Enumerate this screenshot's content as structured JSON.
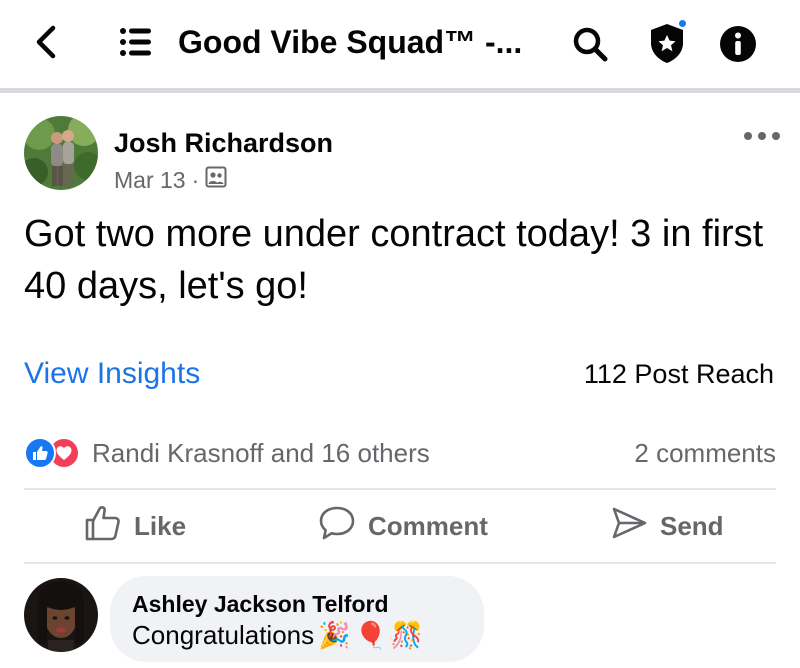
{
  "header": {
    "title": "Good Vibe Squad™ -...",
    "icons": [
      "back-arrow-icon",
      "menu-icon",
      "search-icon",
      "admin-shield-icon",
      "info-icon"
    ],
    "notification_dot_color": "#1877f2"
  },
  "post": {
    "author": "Josh Richardson",
    "date": "Mar 13",
    "date_separator": "·",
    "audience_icon": "group-members-icon",
    "text": "Got two more under contract today!  3 in first 40 days, let's go!",
    "view_insights": "View Insights",
    "reach": "112 Post Reach",
    "reactions_summary": "Randi Krasnoff and 16 others",
    "reaction_types": [
      "like",
      "love"
    ],
    "comments_count": "2 comments"
  },
  "actions": {
    "like": "Like",
    "comment": "Comment",
    "send": "Send"
  },
  "comment": {
    "author": "Ashley Jackson Telford",
    "text": "Congratulations",
    "emojis": [
      "🎉",
      "🎈",
      "🎊"
    ]
  },
  "colors": {
    "accent": "#1b74e4",
    "like": "#1877f2",
    "love": "#f33e58",
    "secondary_text": "#65676b",
    "bubble": "#f0f2f5"
  }
}
